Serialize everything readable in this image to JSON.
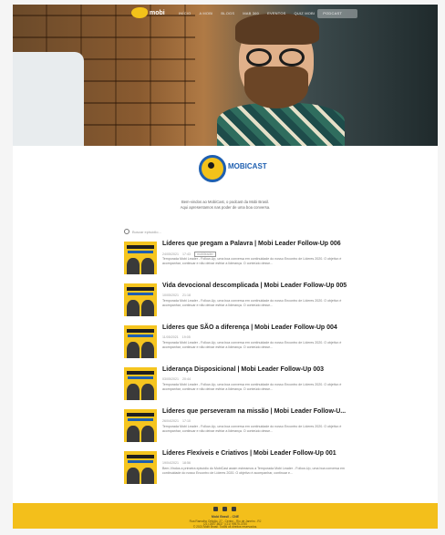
{
  "nav": {
    "brand": "mobi",
    "menu": [
      "INÍCIO",
      "A MOBI",
      "BLOGS",
      "MAB 360",
      "EVENTOS",
      "QUIZ MOBI",
      "PODCAST"
    ]
  },
  "logo": {
    "text": "MOBICAST"
  },
  "intro": {
    "line1": "Bem-vindos ao MobiCast, o podcast da Mobi Brasil.",
    "line2": "Aqui apresentamos nas poder de uma boa conversa."
  },
  "list": {
    "search_placeholder": "Buscar episódio..."
  },
  "episodes": [
    {
      "title": "Líderes que pregam a Palavra | Mobi Leader Follow-Up 006",
      "date": "24/05/2021",
      "duration": "17:43",
      "tag": "mobileader",
      "desc": "Temporada Mobi Leader - Follow-Up, uma boa conversa em continuidade do nosso Encontro de Líderes 2020. O objetivo é acompanhar, continuar e não deixar esfriar a liderança. O conteúdo desse..."
    },
    {
      "title": "Vida devocional descomplicada | Mobi Leader Follow-Up 005",
      "date": "10/05/2021",
      "duration": "21:18",
      "tag": "",
      "desc": "Temporada Mobi Leader - Follow-Up, uma boa conversa em continuidade do nosso Encontro de Líderes 2020. O objetivo é acompanhar, continuar e não deixar esfriar a liderança. O conteúdo desse..."
    },
    {
      "title": "Líderes que SÃO a diferença | Mobi Leader Follow-Up 004",
      "date": "11/05/2021",
      "duration": "19:05",
      "tag": "",
      "desc": "Temporada Mobi Leader - Follow-Up, uma boa conversa em continuidade do nosso Encontro de Líderes 2020. O objetivo é acompanhar, continuar e não deixar esfriar a liderança. O conteúdo desse..."
    },
    {
      "title": "Liderança Disposicional | Mobi Leader Follow-Up 003",
      "date": "03/05/2021",
      "duration": "20:44",
      "tag": "",
      "desc": "Temporada Mobi Leader - Follow-Up, uma boa conversa em continuidade do nosso Encontro de Líderes 2020. O objetivo é acompanhar, continuar e não deixar esfriar a liderança. O conteúdo desse..."
    },
    {
      "title": "Líderes que perseveram na missão | Mobi Leader Follow-U...",
      "date": "26/04/2021",
      "duration": "17:10",
      "tag": "",
      "desc": "Temporada Mobi Leader - Follow-Up, uma boa conversa em continuidade do nosso Encontro de Líderes 2020. O objetivo é acompanhar, continuar e não deixar esfriar a liderança. O conteúdo desse..."
    },
    {
      "title": "Líderes Flexíveis e Criativos | Mobi Leader Follow-Up 001",
      "date": "19/04/2021",
      "duration": "18:56",
      "tag": "",
      "desc": "Bem-Vindos a primeira episódio do MobiCast assim estreamos a Temporada Mobi Leader - Follow-Up, uma boa conversa em continuidade do nosso Encontro de Líderes 2020. O objetivo é acompanhar, continuar e..."
    }
  ],
  "footer": {
    "name": "Mobi Brasil - CNE",
    "line1": "Rua Ramalho Ortigão, 27 - Centro - Rio de Janeiro - RJ",
    "line2": "(21) 2507-6637 | (21) 99575-3750",
    "line3": "© 2021 Mobi Brasil. Todos os direitos reservados."
  },
  "colors": {
    "accent": "#f3bf1b",
    "brand_blue": "#1e5fb0"
  }
}
